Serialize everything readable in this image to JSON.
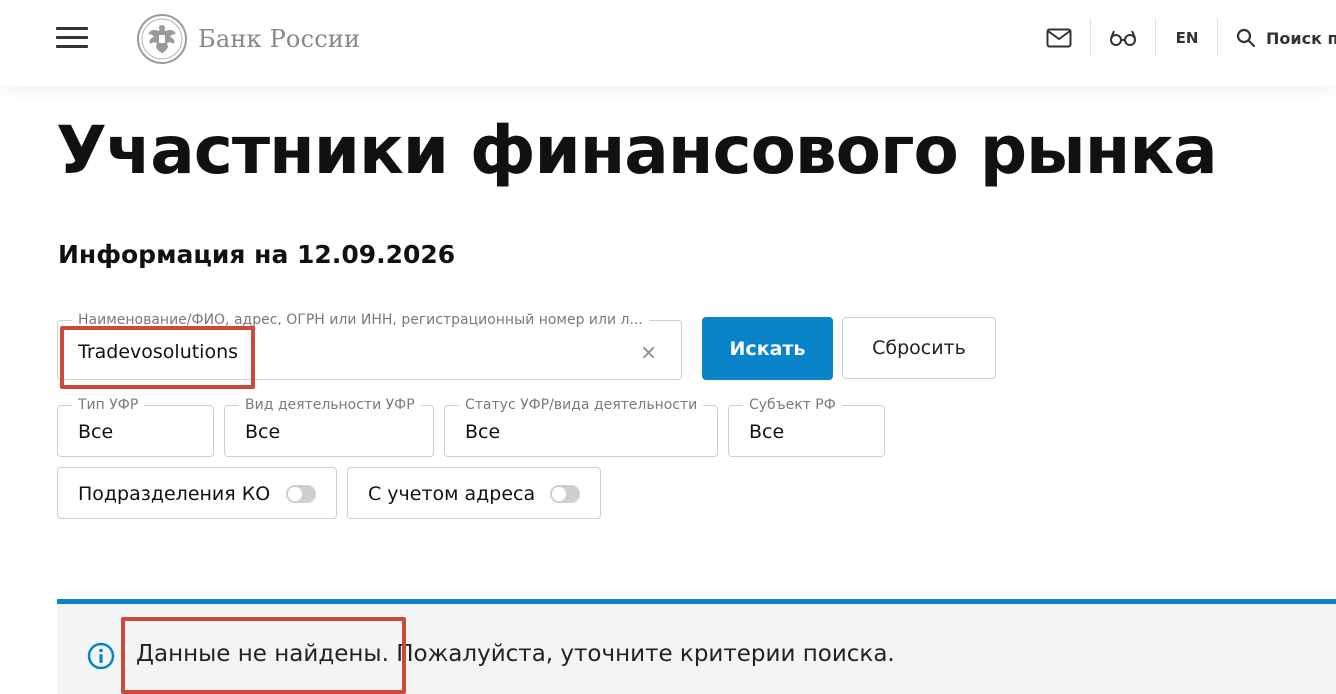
{
  "header": {
    "logo_text": "Банк России",
    "lang_label": "EN",
    "search_label": "Поиск по"
  },
  "main": {
    "title": "Участники финансового рынка",
    "info_date": "Информация на 12.09.2026"
  },
  "search": {
    "label": "Наименование/ФИО, адрес, ОГРН или ИНН, регистрационный номер или л...",
    "value": "Tradevosolutions",
    "clear_symbol": "×",
    "submit_label": "Искать",
    "reset_label": "Сбросить"
  },
  "filters": [
    {
      "label": "Тип УФР",
      "value": "Все"
    },
    {
      "label": "Вид деятельности УФР",
      "value": "Все"
    },
    {
      "label": "Статус УФР/вида деятельности",
      "value": "Все"
    },
    {
      "label": "Субъект РФ",
      "value": "Все"
    }
  ],
  "toggles": [
    {
      "label": "Подразделения КО",
      "checked": false
    },
    {
      "label": "С учетом адреса",
      "checked": false
    }
  ],
  "alert": {
    "text": "Данные не найдены. Пожалуйста, уточните критерии поиска."
  },
  "colors": {
    "accent": "#0a84c9",
    "annotation": "#cc4a3b",
    "alert_bg": "#f2f4f5"
  },
  "icons": [
    "menu-icon",
    "emblem-icon",
    "mail-icon",
    "glasses-icon",
    "search-icon",
    "info-icon"
  ]
}
